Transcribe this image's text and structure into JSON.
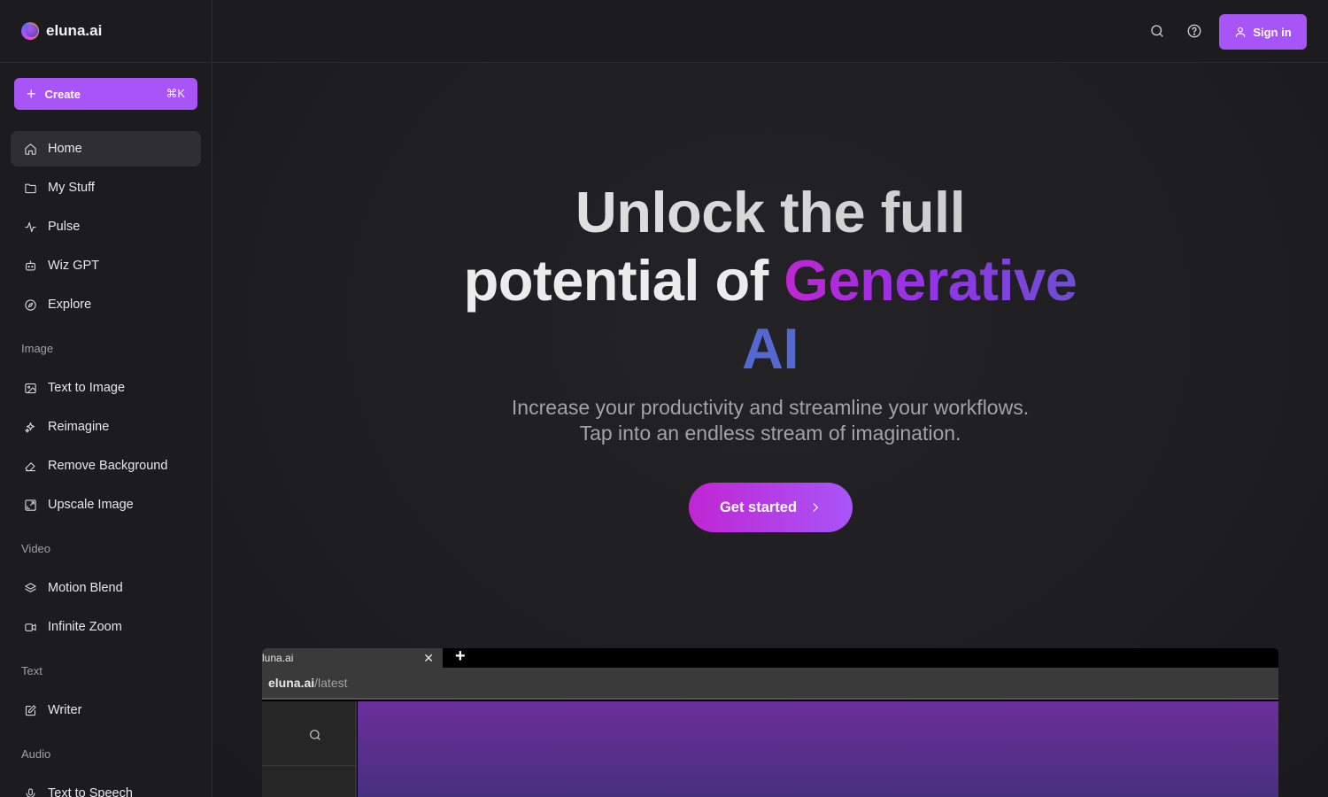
{
  "brand": {
    "name": "eluna.ai"
  },
  "sidebar": {
    "create": {
      "label": "Create",
      "shortcut": "⌘K"
    },
    "primary": [
      {
        "label": "Home",
        "icon": "home-icon",
        "active": true
      },
      {
        "label": "My Stuff",
        "icon": "folder-icon"
      },
      {
        "label": "Pulse",
        "icon": "activity-icon"
      },
      {
        "label": "Wiz GPT",
        "icon": "bot-icon"
      },
      {
        "label": "Explore",
        "icon": "compass-icon"
      }
    ],
    "sections": {
      "image": {
        "label": "Image",
        "items": [
          {
            "label": "Text to Image",
            "icon": "image-icon"
          },
          {
            "label": "Reimagine",
            "icon": "sparkles-icon"
          },
          {
            "label": "Remove Background",
            "icon": "eraser-icon"
          },
          {
            "label": "Upscale Image",
            "icon": "expand-icon"
          }
        ]
      },
      "video": {
        "label": "Video",
        "items": [
          {
            "label": "Motion Blend",
            "icon": "layers-icon"
          },
          {
            "label": "Infinite Zoom",
            "icon": "video-icon"
          }
        ]
      },
      "text": {
        "label": "Text",
        "items": [
          {
            "label": "Writer",
            "icon": "pencil-square-icon"
          }
        ]
      },
      "audio": {
        "label": "Audio",
        "items": [
          {
            "label": "Text to Speech",
            "icon": "mic-icon"
          }
        ]
      }
    }
  },
  "header": {
    "signin_label": "Sign in"
  },
  "hero": {
    "title_line1": "Unlock the full",
    "title_line2_prefix": "potential of ",
    "title_highlight": "Generative",
    "title_line3": "AI",
    "subtitle_line1": "Increase your productivity and streamline your workflows.",
    "subtitle_line2": "Tap into an endless stream of imagination.",
    "cta_label": "Get started"
  },
  "mockup": {
    "tab_title": "luna.ai",
    "url_host": "eluna.ai",
    "url_path": "/latest",
    "close_glyph": "✕",
    "plus_glyph": "+"
  },
  "colors": {
    "accent": "#a855f7",
    "gradient_start": "#c026d3",
    "gradient_end": "#5865d8",
    "background": "#1c1c1e"
  }
}
